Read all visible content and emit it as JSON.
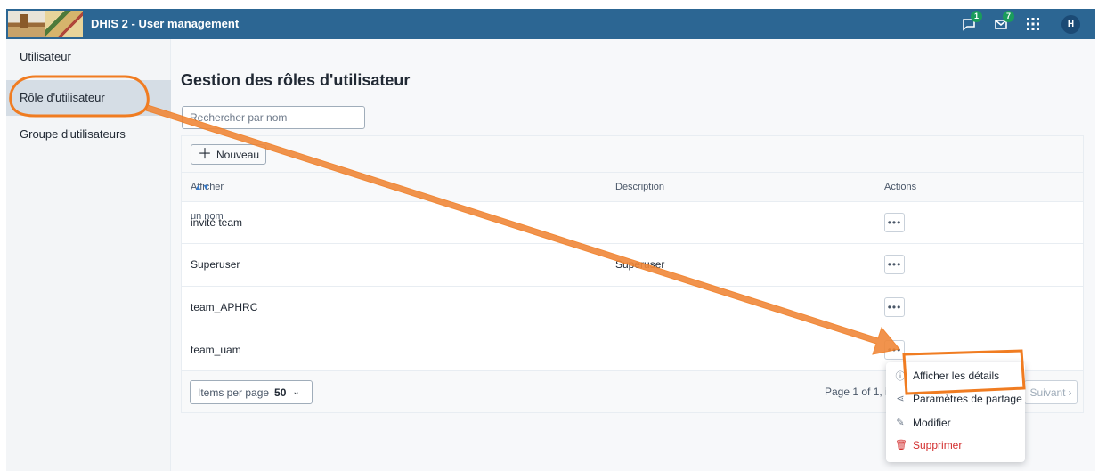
{
  "header": {
    "app_title": "DHIS 2 - User management",
    "interpretations_badge": "1",
    "messages_badge": "7",
    "avatar_initial": "H",
    "bg_color": "#2c6693"
  },
  "sidebar": {
    "items": [
      {
        "label": "Utilisateur"
      },
      {
        "label": "Rôle d'utilisateur"
      },
      {
        "label": "Groupe d'utilisateurs"
      }
    ]
  },
  "main": {
    "title": "Gestion des rôles d'utilisateur",
    "search_placeholder": "Rechercher par nom",
    "new_button": "Nouveau",
    "columns": {
      "name": "Afficher un nom",
      "description": "Description",
      "actions": "Actions"
    },
    "rows": [
      {
        "name": "invité team",
        "description": ""
      },
      {
        "name": "Superuser",
        "description": "Superuser"
      },
      {
        "name": "team_APHRC",
        "description": ""
      },
      {
        "name": "team_uam",
        "description": ""
      }
    ],
    "footer": {
      "items_per_page_label": "Items per page",
      "items_per_page_value": "50",
      "page_info": "Page 1 of 1, it",
      "next_label": "Suivant"
    }
  },
  "context_menu": {
    "items": [
      {
        "label": "Afficher les détails",
        "icon": "info-icon"
      },
      {
        "label": "Paramètres de partage",
        "icon": "share-icon"
      },
      {
        "label": "Modifier",
        "icon": "pencil-icon"
      },
      {
        "label": "Supprimer",
        "icon": "trash-icon"
      }
    ]
  },
  "colors": {
    "annotation": "#f07c21",
    "danger": "#d32f2f",
    "badge": "#1a9c5c"
  }
}
